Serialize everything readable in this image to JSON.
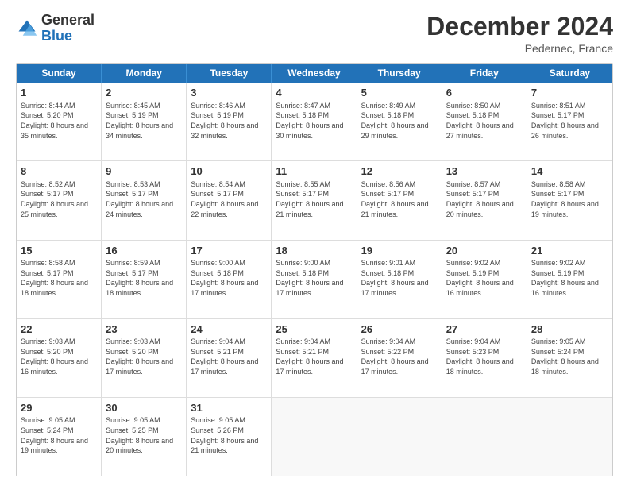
{
  "logo": {
    "general": "General",
    "blue": "Blue"
  },
  "title": "December 2024",
  "location": "Pedernec, France",
  "days": [
    "Sunday",
    "Monday",
    "Tuesday",
    "Wednesday",
    "Thursday",
    "Friday",
    "Saturday"
  ],
  "rows": [
    [
      {
        "day": "1",
        "rise": "Sunrise: 8:44 AM",
        "set": "Sunset: 5:20 PM",
        "day_text": "Daylight: 8 hours and 35 minutes."
      },
      {
        "day": "2",
        "rise": "Sunrise: 8:45 AM",
        "set": "Sunset: 5:19 PM",
        "day_text": "Daylight: 8 hours and 34 minutes."
      },
      {
        "day": "3",
        "rise": "Sunrise: 8:46 AM",
        "set": "Sunset: 5:19 PM",
        "day_text": "Daylight: 8 hours and 32 minutes."
      },
      {
        "day": "4",
        "rise": "Sunrise: 8:47 AM",
        "set": "Sunset: 5:18 PM",
        "day_text": "Daylight: 8 hours and 30 minutes."
      },
      {
        "day": "5",
        "rise": "Sunrise: 8:49 AM",
        "set": "Sunset: 5:18 PM",
        "day_text": "Daylight: 8 hours and 29 minutes."
      },
      {
        "day": "6",
        "rise": "Sunrise: 8:50 AM",
        "set": "Sunset: 5:18 PM",
        "day_text": "Daylight: 8 hours and 27 minutes."
      },
      {
        "day": "7",
        "rise": "Sunrise: 8:51 AM",
        "set": "Sunset: 5:17 PM",
        "day_text": "Daylight: 8 hours and 26 minutes."
      }
    ],
    [
      {
        "day": "8",
        "rise": "Sunrise: 8:52 AM",
        "set": "Sunset: 5:17 PM",
        "day_text": "Daylight: 8 hours and 25 minutes."
      },
      {
        "day": "9",
        "rise": "Sunrise: 8:53 AM",
        "set": "Sunset: 5:17 PM",
        "day_text": "Daylight: 8 hours and 24 minutes."
      },
      {
        "day": "10",
        "rise": "Sunrise: 8:54 AM",
        "set": "Sunset: 5:17 PM",
        "day_text": "Daylight: 8 hours and 22 minutes."
      },
      {
        "day": "11",
        "rise": "Sunrise: 8:55 AM",
        "set": "Sunset: 5:17 PM",
        "day_text": "Daylight: 8 hours and 21 minutes."
      },
      {
        "day": "12",
        "rise": "Sunrise: 8:56 AM",
        "set": "Sunset: 5:17 PM",
        "day_text": "Daylight: 8 hours and 21 minutes."
      },
      {
        "day": "13",
        "rise": "Sunrise: 8:57 AM",
        "set": "Sunset: 5:17 PM",
        "day_text": "Daylight: 8 hours and 20 minutes."
      },
      {
        "day": "14",
        "rise": "Sunrise: 8:58 AM",
        "set": "Sunset: 5:17 PM",
        "day_text": "Daylight: 8 hours and 19 minutes."
      }
    ],
    [
      {
        "day": "15",
        "rise": "Sunrise: 8:58 AM",
        "set": "Sunset: 5:17 PM",
        "day_text": "Daylight: 8 hours and 18 minutes."
      },
      {
        "day": "16",
        "rise": "Sunrise: 8:59 AM",
        "set": "Sunset: 5:17 PM",
        "day_text": "Daylight: 8 hours and 18 minutes."
      },
      {
        "day": "17",
        "rise": "Sunrise: 9:00 AM",
        "set": "Sunset: 5:18 PM",
        "day_text": "Daylight: 8 hours and 17 minutes."
      },
      {
        "day": "18",
        "rise": "Sunrise: 9:00 AM",
        "set": "Sunset: 5:18 PM",
        "day_text": "Daylight: 8 hours and 17 minutes."
      },
      {
        "day": "19",
        "rise": "Sunrise: 9:01 AM",
        "set": "Sunset: 5:18 PM",
        "day_text": "Daylight: 8 hours and 17 minutes."
      },
      {
        "day": "20",
        "rise": "Sunrise: 9:02 AM",
        "set": "Sunset: 5:19 PM",
        "day_text": "Daylight: 8 hours and 16 minutes."
      },
      {
        "day": "21",
        "rise": "Sunrise: 9:02 AM",
        "set": "Sunset: 5:19 PM",
        "day_text": "Daylight: 8 hours and 16 minutes."
      }
    ],
    [
      {
        "day": "22",
        "rise": "Sunrise: 9:03 AM",
        "set": "Sunset: 5:20 PM",
        "day_text": "Daylight: 8 hours and 16 minutes."
      },
      {
        "day": "23",
        "rise": "Sunrise: 9:03 AM",
        "set": "Sunset: 5:20 PM",
        "day_text": "Daylight: 8 hours and 17 minutes."
      },
      {
        "day": "24",
        "rise": "Sunrise: 9:04 AM",
        "set": "Sunset: 5:21 PM",
        "day_text": "Daylight: 8 hours and 17 minutes."
      },
      {
        "day": "25",
        "rise": "Sunrise: 9:04 AM",
        "set": "Sunset: 5:21 PM",
        "day_text": "Daylight: 8 hours and 17 minutes."
      },
      {
        "day": "26",
        "rise": "Sunrise: 9:04 AM",
        "set": "Sunset: 5:22 PM",
        "day_text": "Daylight: 8 hours and 17 minutes."
      },
      {
        "day": "27",
        "rise": "Sunrise: 9:04 AM",
        "set": "Sunset: 5:23 PM",
        "day_text": "Daylight: 8 hours and 18 minutes."
      },
      {
        "day": "28",
        "rise": "Sunrise: 9:05 AM",
        "set": "Sunset: 5:24 PM",
        "day_text": "Daylight: 8 hours and 18 minutes."
      }
    ],
    [
      {
        "day": "29",
        "rise": "Sunrise: 9:05 AM",
        "set": "Sunset: 5:24 PM",
        "day_text": "Daylight: 8 hours and 19 minutes."
      },
      {
        "day": "30",
        "rise": "Sunrise: 9:05 AM",
        "set": "Sunset: 5:25 PM",
        "day_text": "Daylight: 8 hours and 20 minutes."
      },
      {
        "day": "31",
        "rise": "Sunrise: 9:05 AM",
        "set": "Sunset: 5:26 PM",
        "day_text": "Daylight: 8 hours and 21 minutes."
      },
      null,
      null,
      null,
      null
    ]
  ]
}
